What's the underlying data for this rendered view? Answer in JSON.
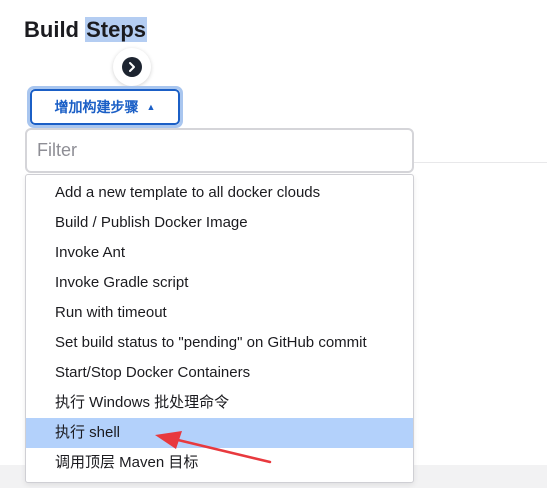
{
  "section": {
    "title_prefix": "Build ",
    "title_selected": "Steps"
  },
  "add_step_button": {
    "label": "增加构建步骤",
    "caret": "▲"
  },
  "filter": {
    "placeholder": "Filter",
    "value": ""
  },
  "menu": {
    "items": [
      {
        "label": "Add a new template to all docker clouds"
      },
      {
        "label": "Build / Publish Docker Image"
      },
      {
        "label": "Invoke Ant"
      },
      {
        "label": "Invoke Gradle script"
      },
      {
        "label": "Run with timeout"
      },
      {
        "label": "Set build status to \"pending\" on GitHub commit"
      },
      {
        "label": "Start/Stop Docker Containers"
      },
      {
        "label": "执行 Windows 批处理命令"
      },
      {
        "label": "执行 shell",
        "highlighted": true
      },
      {
        "label": "调用顶层 Maven 目标"
      }
    ],
    "highlighted_index": 8
  },
  "colors": {
    "accent": "#1b5fc6",
    "selection": "#b3d1fb",
    "annotation_arrow": "#e8393e"
  }
}
